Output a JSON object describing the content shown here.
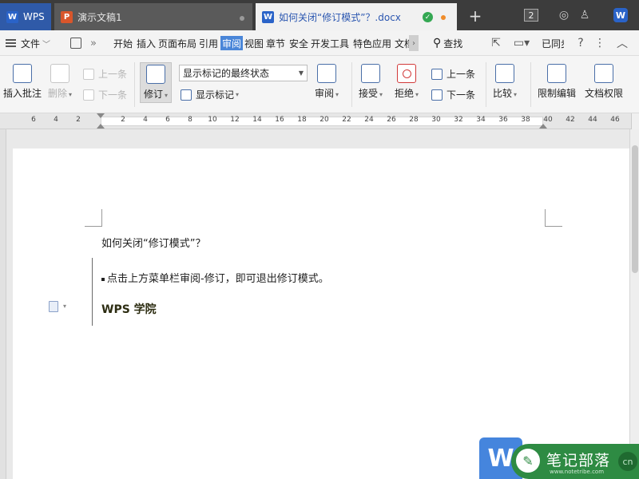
{
  "tabs": [
    {
      "label": "WPS",
      "icon": "wps-logo-icon"
    },
    {
      "label": "演示文稿1",
      "icon": "presentation-icon"
    },
    {
      "label": "如何关闭“修订模式”？.docx",
      "icon": "word-doc-icon"
    }
  ],
  "titlebar": {
    "window_count": "2",
    "avatar_letter": "W"
  },
  "menu": {
    "file_label": "文件",
    "items": [
      "开始",
      "插入",
      "页面布局",
      "引用",
      "审阅",
      "视图",
      "章节",
      "安全",
      "开发工具",
      "特色应用",
      "文档"
    ],
    "active": "审阅",
    "search_label": "查找",
    "sync_label": "已同步",
    "help_label": "?",
    "more_label": "⋮"
  },
  "ribbon": {
    "insert_comment": "插入批注",
    "delete": "删除",
    "prev_comment": "上一条",
    "next_comment": "下一条",
    "track_changes": "修订",
    "display_select": "显示标记的最终状态",
    "show_markup": "显示标记",
    "review": "审阅",
    "accept": "接受",
    "reject": "拒绝",
    "prev_change": "上一条",
    "next_change": "下一条",
    "compare": "比较",
    "restrict_editing": "限制编辑",
    "document_rights": "文档权限"
  },
  "ruler": {
    "ticks": [
      "6",
      "4",
      "2",
      "2",
      "4",
      "6",
      "8",
      "10",
      "12",
      "14",
      "16",
      "18",
      "20",
      "22",
      "24",
      "26",
      "28",
      "30",
      "32",
      "34",
      "36",
      "38",
      "40",
      "42",
      "44",
      "46"
    ]
  },
  "document": {
    "title": "如何关闭“修订模式”？",
    "body": "点击上方菜单栏审阅-修订，即可退出修订模式。",
    "signature": "WPS 学院"
  },
  "watermark": {
    "logo_letter": "W",
    "site_name": "笔记部落",
    "site_url": "www.notetribe.com",
    "cn": "cn"
  },
  "colors": {
    "accent": "#4a86d8",
    "tabbar": "#3c3c3c",
    "wps_blue": "#2f5aa8",
    "ppt_orange": "#d9562b",
    "watermark_green": "#2e8b43"
  }
}
